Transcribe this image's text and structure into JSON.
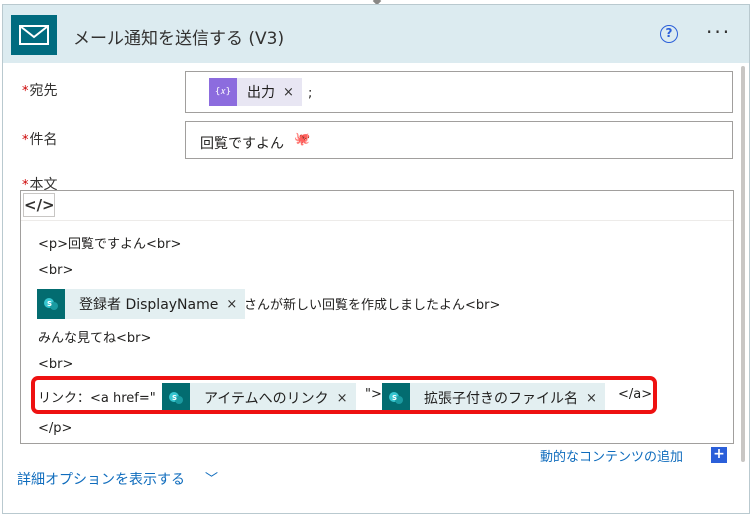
{
  "header": {
    "title": "メール通知を送信する (V3)",
    "help_glyph": "?",
    "more_glyph": "···",
    "icon": "mail-icon",
    "icon_bg": "#006b7f",
    "bg": "#dcebf0"
  },
  "fields": {
    "to": {
      "label": "宛先",
      "required": "*",
      "token": {
        "label": "出力",
        "icon": "expression-icon",
        "icon_glyph": "{𝑥}"
      },
      "suffix": ";"
    },
    "subject": {
      "label": "件名",
      "required": "*",
      "value": "回覧ですよん",
      "emoji": "🐙"
    },
    "body": {
      "label": "本文",
      "required": "*",
      "code_button": "</>"
    }
  },
  "body_lines": {
    "line1": "<p>回覧ですよん<br>",
    "line2": "<br>",
    "line3_token": "登録者 DisplayName",
    "line3_text": "さんが新しい回覧を作成しましたよん<br>",
    "line4": "みんな見てね<br>",
    "line5": "<br>",
    "line6_prefix": "リンク：<a href=\"",
    "line6_token1": "アイテムへのリンク",
    "line6_mid": "\">",
    "line6_token2": "拡張子付きのファイル名",
    "line6_suffix": "</a>",
    "line7": "</p>"
  },
  "token_close_glyph": "×",
  "dynamic_content_link": "動的なコンテンツの追加",
  "dynamic_content_plus": "+",
  "advanced_options": "詳細オプションを表示する",
  "advanced_chevron": "﹀",
  "colors": {
    "accent": "#0f6cbd",
    "highlight": "#ee1111",
    "token_purple": "#8c6cde",
    "token_teal": "#036c70",
    "required": "#cc0000"
  }
}
